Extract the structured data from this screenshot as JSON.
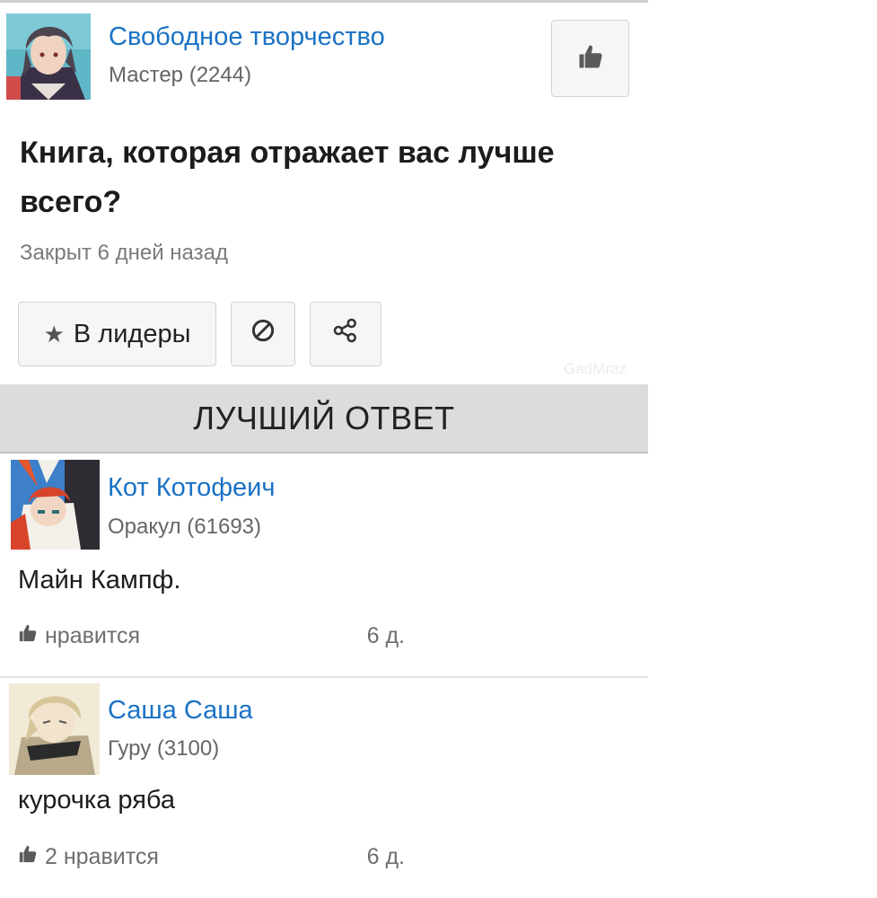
{
  "question_header": {
    "category": "Свободное творчество",
    "author_rank": "Мастер (2244)",
    "like_icon": "thumbs-up-icon"
  },
  "question": {
    "title": "Книга, которая отражает вас лучше всего?",
    "status": "Закрыт 6 дней назад"
  },
  "actions": {
    "leaders_label": "В лидеры",
    "leaders_icon": "star-icon",
    "report_icon": "block-icon",
    "share_icon": "share-icon"
  },
  "watermark": "GadMraz",
  "best_answer_label": "ЛУЧШИЙ ОТВЕТ",
  "answers": [
    {
      "author": "Кот Котофеич",
      "rank": "Оракул (61693)",
      "text": "Майн Кампф.",
      "likes": "нравится",
      "age": "6 д."
    },
    {
      "author": "Саша Саша",
      "rank": "Гуру (3100)",
      "text": "курочка ряба",
      "likes": "2 нравится",
      "age": "6 д."
    }
  ],
  "colors": {
    "link": "#1a72c4",
    "bar": "#dcdcdc"
  }
}
